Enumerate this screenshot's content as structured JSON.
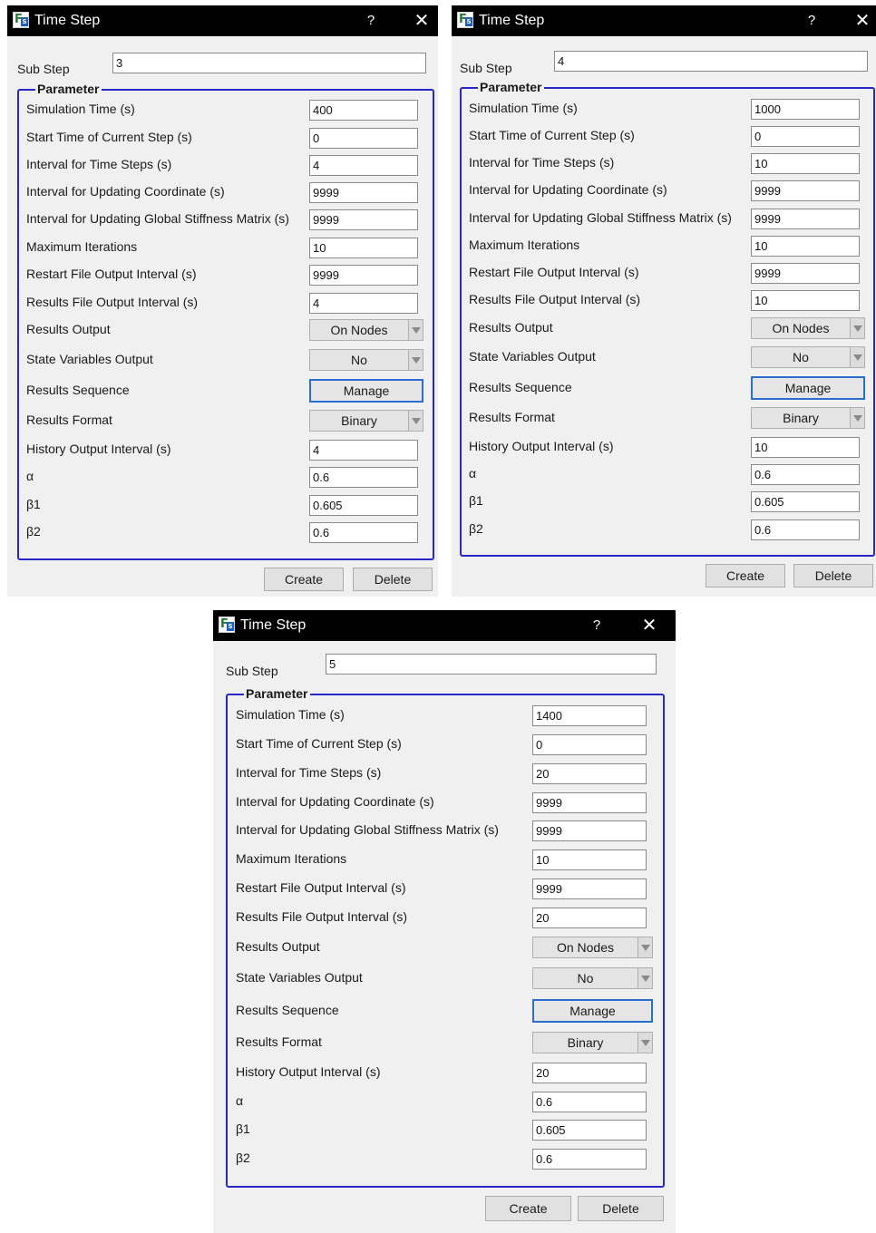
{
  "dialogs": [
    {
      "title": "Time Step",
      "help_glyph": "?",
      "close_glyph": "✕",
      "sub_step_label": "Sub Step",
      "sub_step_value": "3",
      "group_title": "Parameter",
      "labels": {
        "sim_time": "Simulation Time (s)",
        "start_time": "Start Time of Current Step (s)",
        "interval_steps": "Interval for Time Steps (s)",
        "interval_coord": "Interval for Updating Coordinate (s)",
        "interval_stiff": "Interval for Updating Global Stiffness Matrix (s)",
        "max_iter": "Maximum Iterations",
        "restart_interval": "Restart File Output Interval (s)",
        "results_interval": "Results File Output Interval (s)",
        "results_output": "Results Output",
        "state_output": "State Variables Output",
        "results_sequence": "Results Sequence",
        "results_format": "Results Format",
        "history_interval": "History Output Interval (s)",
        "alpha": "α",
        "beta1": "β1",
        "beta2": "β2"
      },
      "values": {
        "sim_time": "400",
        "start_time": "0",
        "interval_steps": "4",
        "interval_coord": "9999",
        "interval_stiff": "9999",
        "max_iter": "10",
        "restart_interval": "9999",
        "results_interval": "4",
        "results_output": "On Nodes",
        "state_output": "No",
        "results_sequence": "Manage",
        "results_format": "Binary",
        "history_interval": "4",
        "alpha": "0.6",
        "beta1": "0.605",
        "beta2": "0.6"
      },
      "create_label": "Create",
      "delete_label": "Delete"
    },
    {
      "title": "Time Step",
      "help_glyph": "?",
      "close_glyph": "✕",
      "sub_step_label": "Sub Step",
      "sub_step_value": "4",
      "group_title": "Parameter",
      "labels": {
        "sim_time": "Simulation Time (s)",
        "start_time": "Start Time of Current Step (s)",
        "interval_steps": "Interval for Time Steps (s)",
        "interval_coord": "Interval for Updating Coordinate (s)",
        "interval_stiff": "Interval for Updating Global Stiffness Matrix (s)",
        "max_iter": "Maximum Iterations",
        "restart_interval": "Restart File Output Interval (s)",
        "results_interval": "Results File Output Interval (s)",
        "results_output": "Results Output",
        "state_output": "State Variables Output",
        "results_sequence": "Results Sequence",
        "results_format": "Results Format",
        "history_interval": "History Output Interval (s)",
        "alpha": "α",
        "beta1": "β1",
        "beta2": "β2"
      },
      "values": {
        "sim_time": "1000",
        "start_time": "0",
        "interval_steps": "10",
        "interval_coord": "9999",
        "interval_stiff": "9999",
        "max_iter": "10",
        "restart_interval": "9999",
        "results_interval": "10",
        "results_output": "On Nodes",
        "state_output": "No",
        "results_sequence": "Manage",
        "results_format": "Binary",
        "history_interval": "10",
        "alpha": "0.6",
        "beta1": "0.605",
        "beta2": "0.6"
      },
      "create_label": "Create",
      "delete_label": "Delete"
    },
    {
      "title": "Time Step",
      "help_glyph": "?",
      "close_glyph": "✕",
      "sub_step_label": "Sub Step",
      "sub_step_value": "5",
      "group_title": "Parameter",
      "labels": {
        "sim_time": "Simulation Time (s)",
        "start_time": "Start Time of Current Step (s)",
        "interval_steps": "Interval for Time Steps (s)",
        "interval_coord": "Interval for Updating Coordinate (s)",
        "interval_stiff": "Interval for Updating Global Stiffness Matrix (s)",
        "max_iter": "Maximum Iterations",
        "restart_interval": "Restart File Output Interval (s)",
        "results_interval": "Results File Output Interval (s)",
        "results_output": "Results Output",
        "state_output": "State Variables Output",
        "results_sequence": "Results Sequence",
        "results_format": "Results Format",
        "history_interval": "History Output Interval (s)",
        "alpha": "α",
        "beta1": "β1",
        "beta2": "β2"
      },
      "values": {
        "sim_time": "1400",
        "start_time": "0",
        "interval_steps": "20",
        "interval_coord": "9999",
        "interval_stiff": "9999",
        "max_iter": "10",
        "restart_interval": "9999",
        "results_interval": "20",
        "results_output": "On Nodes",
        "state_output": "No",
        "results_sequence": "Manage",
        "results_format": "Binary",
        "history_interval": "20",
        "alpha": "0.6",
        "beta1": "0.605",
        "beta2": "0.6"
      },
      "create_label": "Create",
      "delete_label": "Delete"
    }
  ]
}
